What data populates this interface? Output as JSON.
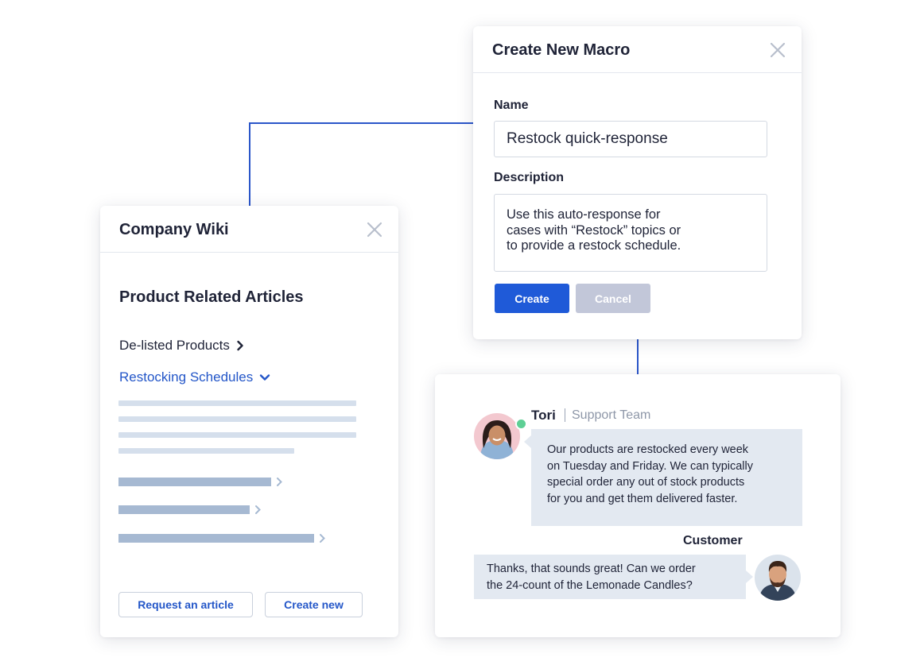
{
  "colors": {
    "accent": "#1f5ad8",
    "link": "#2356c8",
    "connector": "#2b56c9",
    "disabled": "#c2c7d9",
    "bubble": "#e3e9f1",
    "online": "#5ecf95"
  },
  "macro": {
    "title": "Create New Macro",
    "name_label": "Name",
    "name_value": "Restock quick-response",
    "description_label": "Description",
    "description_lines": [
      "Use this auto-response for",
      "cases with “Restock” topics or",
      "to provide a restock schedule."
    ],
    "create_label": "Create",
    "cancel_label": "Cancel",
    "close_icon": "close-icon"
  },
  "wiki": {
    "title": "Company Wiki",
    "section_title": "Product Related Articles",
    "links": [
      {
        "label": "De-listed Products",
        "icon": "chevron-right-icon"
      },
      {
        "label": "Restocking Schedules",
        "icon": "chevron-down-icon"
      }
    ],
    "request_label": "Request an article",
    "create_label": "Create new",
    "close_icon": "close-icon"
  },
  "chat": {
    "agent": {
      "name": "Tori",
      "team": "Support Team",
      "message_lines": [
        "Our products are restocked every week",
        "on Tuesday and Friday. We can typically",
        "special order any out of stock products",
        "for you and get them delivered faster."
      ]
    },
    "customer": {
      "name": "Customer",
      "message_lines": [
        "Thanks, that sounds great! Can we order",
        "the 24-count of the Lemonade Candles?"
      ]
    }
  }
}
